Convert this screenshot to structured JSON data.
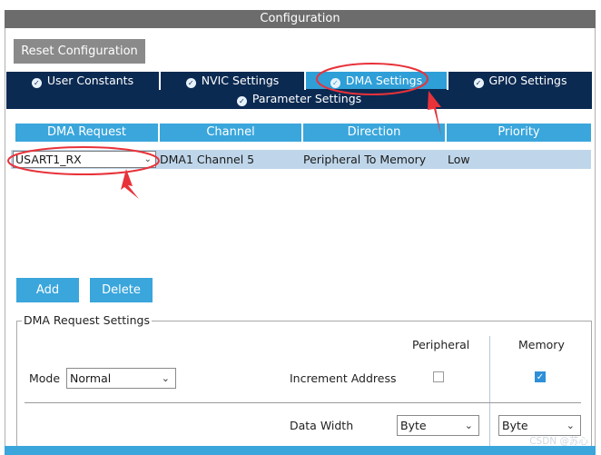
{
  "header": {
    "title": "Configuration"
  },
  "toolbar": {
    "reset_label": "Reset Configuration"
  },
  "tabs": [
    {
      "label": "User Constants",
      "active": false
    },
    {
      "label": "NVIC Settings",
      "active": false
    },
    {
      "label": "DMA Settings",
      "active": true
    },
    {
      "label": "GPIO Settings",
      "active": false
    },
    {
      "label": "Parameter Settings",
      "active": false
    }
  ],
  "dma_table": {
    "columns": [
      "DMA Request",
      "Channel",
      "Direction",
      "Priority"
    ],
    "rows": [
      {
        "request": "USART1_RX",
        "channel": "DMA1 Channel 5",
        "direction": "Peripheral To Memory",
        "priority": "Low"
      }
    ]
  },
  "actions": {
    "add_label": "Add",
    "delete_label": "Delete"
  },
  "settings": {
    "legend": "DMA Request Settings",
    "mode_label": "Mode",
    "mode_value": "Normal",
    "peripheral_header": "Peripheral",
    "memory_header": "Memory",
    "increment_label": "Increment Address",
    "peripheral_increment": false,
    "memory_increment": true,
    "data_width_label": "Data Width",
    "peripheral_width": "Byte",
    "memory_width": "Byte"
  },
  "watermark": "CSDN @苏心",
  "colors": {
    "tab_bg": "#0b2a52",
    "accent": "#3aa6dc",
    "active_tab": "#2f9fd8",
    "row_bg": "#bfd6ea",
    "annotation": "#e8323a"
  },
  "icons": {
    "tab_status": "check-circle-icon",
    "dropdown": "chevron-down-icon"
  }
}
